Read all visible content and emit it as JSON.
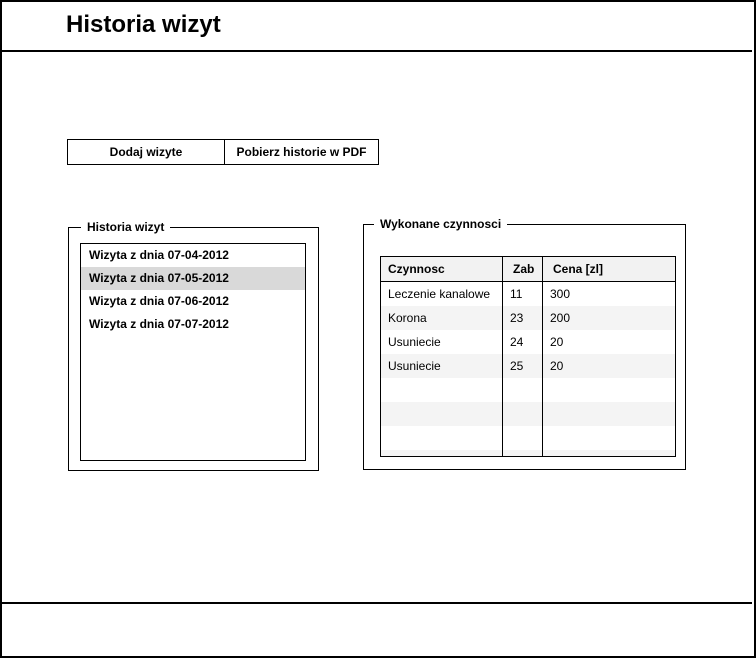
{
  "header": {
    "title": "Historia wizyt"
  },
  "toolbar": {
    "add_label": "Dodaj wizyte",
    "pdf_label": "Pobierz historie w PDF"
  },
  "history": {
    "title": "Historia wizyt",
    "selected_index": 1,
    "items": [
      "Wizyta z dnia 07-04-2012",
      "Wizyta z dnia 07-05-2012",
      "Wizyta z dnia 07-06-2012",
      "Wizyta z dnia 07-07-2012"
    ]
  },
  "procedures": {
    "title": "Wykonane czynnosci",
    "columns": [
      "Czynnosc",
      "Zab",
      "Cena [zl]"
    ],
    "rows": [
      [
        "Leczenie kanalowe",
        "11",
        "300"
      ],
      [
        "Korona",
        "23",
        "200"
      ],
      [
        "Usuniecie",
        "24",
        "20"
      ],
      [
        "Usuniecie",
        "25",
        "20"
      ]
    ],
    "empty_rows": 3
  },
  "colors": {
    "selected_row": "#d9d9d9",
    "header_bg": "#f2f2f2",
    "alt_row": "#f4f4f4"
  }
}
